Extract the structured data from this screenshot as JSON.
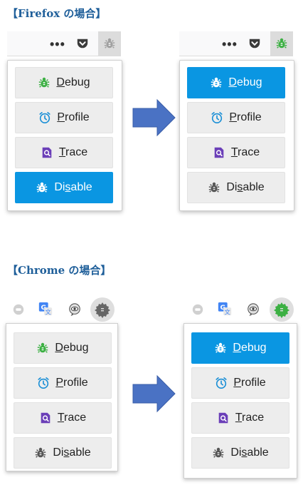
{
  "headings": {
    "firefox": "【Firefox の場合】",
    "chrome": "【Chrome の場合】"
  },
  "colors": {
    "accent_blue": "#0a96e2",
    "bug_green": "#3cb043",
    "bug_gray": "#9a9a9a",
    "profile_blue": "#1a8fd6",
    "trace_purple": "#6b3fb8",
    "arrow_blue": "#4a72c4"
  },
  "toolbar": {
    "overflow_label": "•••"
  },
  "menu": {
    "debug": {
      "pre": "",
      "u": "D",
      "post": "ebug"
    },
    "profile": {
      "pre": "",
      "u": "P",
      "post": "rofile"
    },
    "trace": {
      "pre": "",
      "u": "T",
      "post": "race"
    },
    "disable": {
      "pre": "Di",
      "u": "s",
      "post": "able"
    }
  }
}
